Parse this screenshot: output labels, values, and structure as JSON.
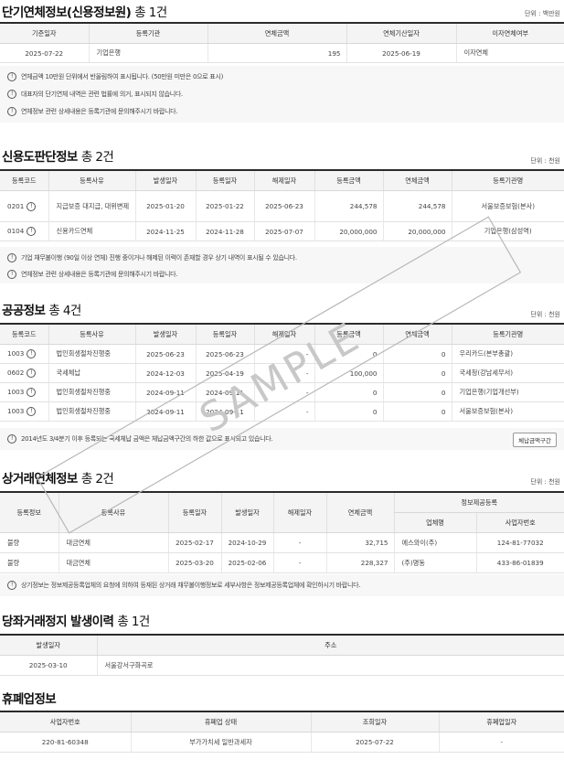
{
  "s1": {
    "title": "단기연체정보(신용정보원)",
    "count": "총 1건",
    "unit": "단위 : 백만원",
    "headers": [
      "기준일자",
      "등록기관",
      "연체금액",
      "연체기산일자",
      "이자연체여부"
    ],
    "rows": [
      [
        "2025-07-22",
        "기업은행",
        "195",
        "2025-06-19",
        "이자연체"
      ]
    ],
    "notes": [
      "연체금액 10만원 단위에서 반올림하여 표시됩니다. (50만원 미만은 0으로 표시)",
      "대표자의 단기연체 내역은 관련 법률에 의거, 표시되지 않습니다.",
      "연체정보 관련 상세내용은 등록기관에 문의해주시기 바랍니다."
    ]
  },
  "s2": {
    "title": "신용도판단정보",
    "count": "총 2건",
    "unit": "단위 : 천원",
    "headers": [
      "등록코드",
      "등록사유",
      "발생일자",
      "등록일자",
      "해제일자",
      "등록금액",
      "연체금액",
      "등록기관명"
    ],
    "rows": [
      [
        "0201",
        "지급보증 대지급, 대위변제",
        "2025-01-20",
        "2025-01-22",
        "2025-06-23",
        "244,578",
        "244,578",
        "서울보증보험(본사)"
      ],
      [
        "0104",
        "신용카드연체",
        "2024-11-25",
        "2024-11-28",
        "2025-07-07",
        "20,000,000",
        "20,000,000",
        "기업은행(삼성역)"
      ]
    ],
    "notes": [
      "기업 채무불이행 (90일 이상 연체) 진행 중이거나 해제된 이력이 존재할 경우 상기 내역이 표시될 수 있습니다.",
      "연체정보 관련 상세내용은 등록기관에 문의해주시기 바랍니다."
    ]
  },
  "s3": {
    "title": "공공정보",
    "count": "총 4건",
    "unit": "단위 : 천원",
    "headers": [
      "등록코드",
      "등록사유",
      "발생일자",
      "등록일자",
      "해제일자",
      "등록금액",
      "연체금액",
      "등록기관명"
    ],
    "rows": [
      [
        "1003",
        "법인회생절차진행중",
        "2025-06-23",
        "2025-06-23",
        "-",
        "0",
        "0",
        "우리카드(본부총괄)"
      ],
      [
        "0602",
        "국세체납",
        "2024-12-03",
        "2025-04-19",
        "-",
        "100,000",
        "0",
        "국세청(강남세무서)"
      ],
      [
        "1003",
        "법인회생절차진행중",
        "2024-09-11",
        "2024-09-11",
        "-",
        "0",
        "0",
        "기업은행(기업개선부)"
      ],
      [
        "1003",
        "법인회생절차진행중",
        "2024-09-11",
        "2024-09-11",
        "-",
        "0",
        "0",
        "서울보증보험(본사)"
      ]
    ],
    "notes": [
      "2014년도 3/4분기 이후 등록되는 국세체납 금액은 체납금액구간의 하한 값으로 표시되고 있습니다."
    ],
    "button": "체납금액구간"
  },
  "s4": {
    "title": "상거래연체정보",
    "count": "총 2건",
    "unit": "단위 : 천원",
    "headers": [
      "등록정보",
      "등록사유",
      "등록일자",
      "발생일자",
      "해제일자",
      "연체금액",
      "정보제공등록"
    ],
    "subheaders": [
      "업체명",
      "사업자번호"
    ],
    "rows": [
      [
        "불량",
        "대금연체",
        "2025-02-17",
        "2024-10-29",
        "-",
        "32,715",
        "에스와이(주)",
        "124-81-77032"
      ],
      [
        "불량",
        "대금연체",
        "2025-03-20",
        "2025-02-06",
        "-",
        "228,327",
        "(주)명동",
        "433-86-01839"
      ]
    ],
    "notes": [
      "상기정보는 정보제공등록업체의 요청에 의하여 등재된 상거래 채무불이행정보로 세부사항은 정보제공등록업체에 확인하시기 바랍니다."
    ]
  },
  "s5": {
    "title": "당좌거래정지 발생이력",
    "count": "총 1건",
    "headers": [
      "발생일자",
      "주소"
    ],
    "rows": [
      [
        "2025-03-10",
        "서울강서구화곡로"
      ]
    ]
  },
  "s6": {
    "title": "휴폐업정보",
    "headers": [
      "사업자번호",
      "휴폐업 상태",
      "조회일자",
      "휴폐업일자"
    ],
    "rows": [
      [
        "220-81-60348",
        "부가가치세 일반과세자",
        "2025-07-22",
        "-"
      ]
    ]
  },
  "watermark": "SAMPLE",
  "icons": {
    "info": "exclamation-circle-icon"
  }
}
